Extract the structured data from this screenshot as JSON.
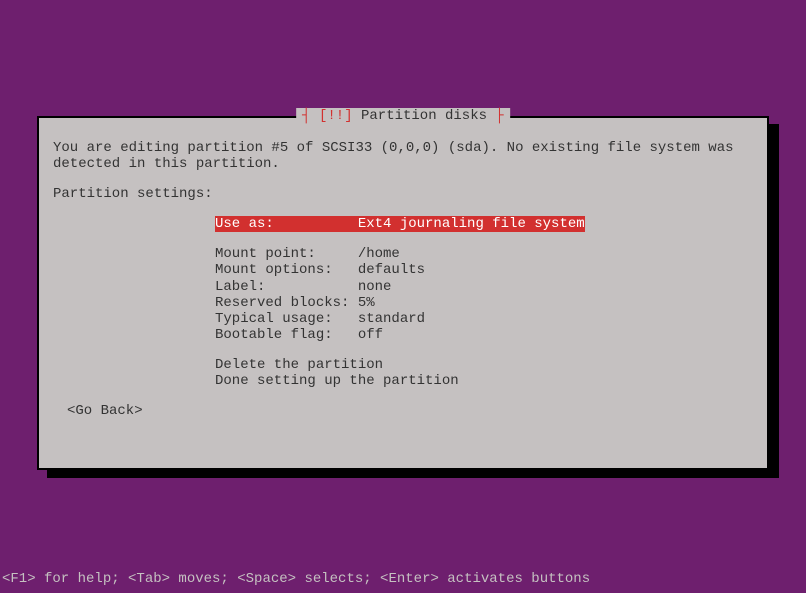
{
  "dialog": {
    "title_prefix": "┤ ",
    "title_warn": "[!!]",
    "title_text": " Partition disks ",
    "title_suffix": "├",
    "description": "You are editing partition #5 of SCSI33 (0,0,0) (sda). No existing file system was detected in this partition.",
    "settings_label": "Partition settings:",
    "settings": {
      "use_as": "Use as:          Ext4 journaling file system",
      "mount_point": "Mount point:     /home",
      "mount_options": "Mount options:   defaults",
      "label": "Label:           none",
      "reserved": "Reserved blocks: 5%",
      "typical_usage": "Typical usage:   standard",
      "bootable": "Bootable flag:   off"
    },
    "actions": {
      "delete": "Delete the partition",
      "done": "Done setting up the partition"
    },
    "go_back": "<Go Back>"
  },
  "footer": "<F1> for help; <Tab> moves; <Space> selects; <Enter> activates buttons"
}
